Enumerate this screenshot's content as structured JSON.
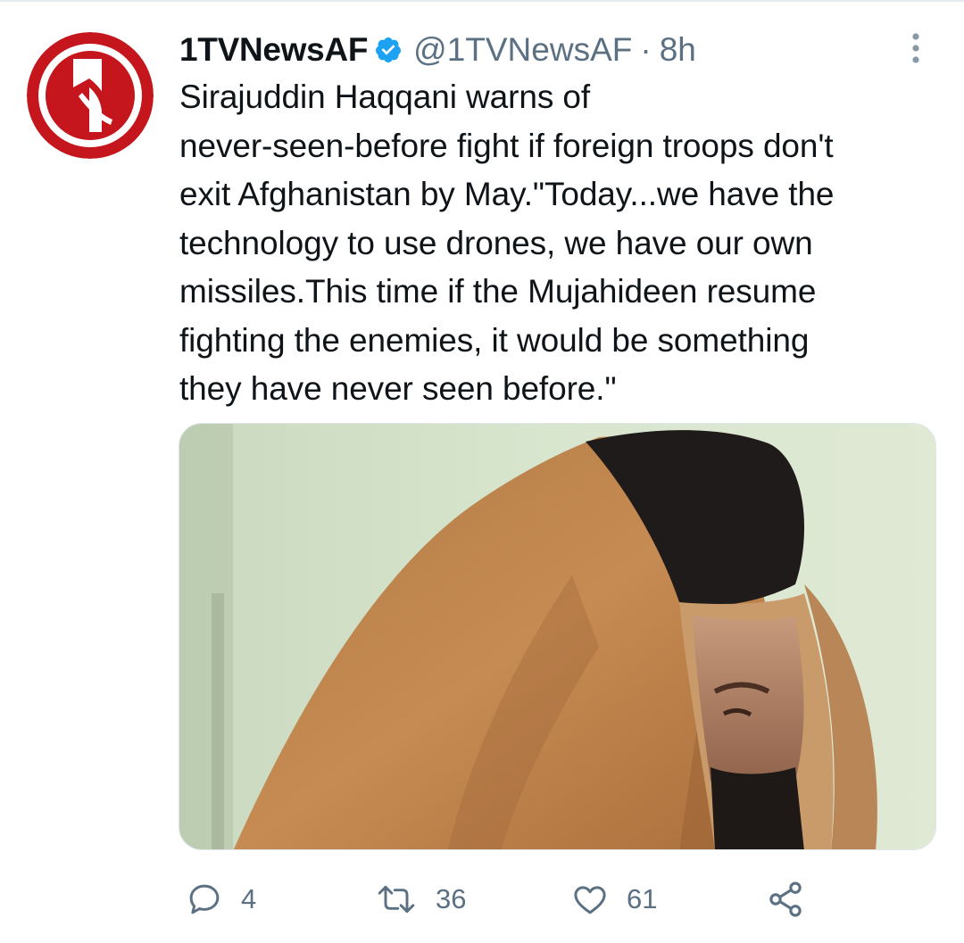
{
  "tweet": {
    "display_name": "1TVNewsAF",
    "verified_icon": "verified-badge-icon",
    "handle": "@1TVNewsAF",
    "separator": "·",
    "time": "8h",
    "text": "Sirajuddin Haqqani warns of\nnever-seen-before fight if foreign troops don't\nexit Afghanistan by May.\"Today...we have the\ntechnology to use drones, we have our own\nmissiles.This time if the Mujahideen resume\nfighting the enemies, it would be something\nthey have never seen before.\""
  },
  "actions": {
    "reply": {
      "icon": "reply-icon",
      "count": "4"
    },
    "retweet": {
      "icon": "retweet-icon",
      "count": "36"
    },
    "like": {
      "icon": "heart-icon",
      "count": "61"
    },
    "share": {
      "icon": "share-icon"
    }
  },
  "colors": {
    "text": "#0f1419",
    "secondary": "#5b7083",
    "verified": "#1da1f2",
    "avatar_red": "#c4161c"
  }
}
